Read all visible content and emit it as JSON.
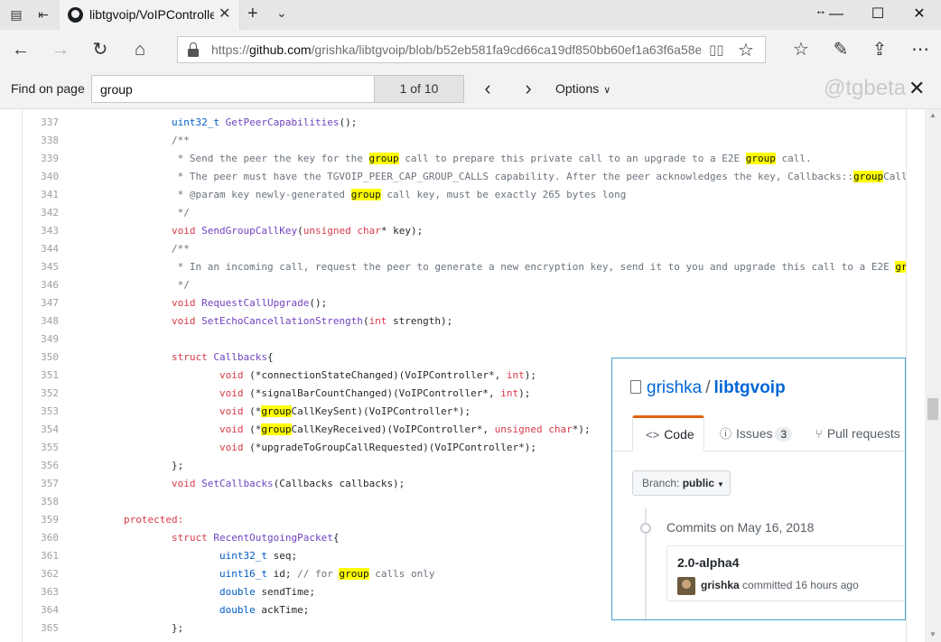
{
  "browser": {
    "tab_title": "libtgvoip/VoIPControlle",
    "url_prefix": "https://",
    "url_domain": "github.com",
    "url_path": "/grishka/libtgvoip/blob/b52eb581fa9cd66ca19df850bb60ef1a63f6a58e/VoIP"
  },
  "find_bar": {
    "label": "Find on page",
    "query": "group",
    "match_count": "1 of 10",
    "options_label": "Options",
    "watermark": "@tgbeta"
  },
  "code_lines": [
    {
      "n": "337",
      "segs": [
        [
          "t",
          "uint32_t"
        ],
        [
          "p",
          " "
        ],
        [
          "f",
          "GetPeerCapabilities"
        ],
        [
          "p",
          "();"
        ]
      ]
    },
    {
      "n": "338",
      "segs": [
        [
          "c",
          "/**"
        ]
      ]
    },
    {
      "n": "339",
      "segs": [
        [
          "c",
          " * Send the peer the key for the "
        ],
        [
          "h",
          "group"
        ],
        [
          "c",
          " call to prepare this private call to an upgrade to a E2E "
        ],
        [
          "h",
          "group"
        ],
        [
          "c",
          " call."
        ]
      ]
    },
    {
      "n": "340",
      "segs": [
        [
          "c",
          " * The peer must have the TGVOIP_PEER_CAP_GROUP_CALLS capability. After the peer acknowledges the key, Callbacks::"
        ],
        [
          "h",
          "group"
        ],
        [
          "c",
          "Call"
        ]
      ]
    },
    {
      "n": "341",
      "segs": [
        [
          "c",
          " * @param key newly-generated "
        ],
        [
          "h",
          "group"
        ],
        [
          "c",
          " call key, must be exactly 265 bytes long"
        ]
      ]
    },
    {
      "n": "342",
      "segs": [
        [
          "c",
          " */"
        ]
      ]
    },
    {
      "n": "343",
      "segs": [
        [
          "k",
          "void"
        ],
        [
          "p",
          " "
        ],
        [
          "f",
          "SendGroupCallKey"
        ],
        [
          "p",
          "("
        ],
        [
          "k",
          "unsigned"
        ],
        [
          "p",
          " "
        ],
        [
          "k",
          "char"
        ],
        [
          "p",
          "* key);"
        ]
      ]
    },
    {
      "n": "344",
      "segs": [
        [
          "c",
          "/**"
        ]
      ]
    },
    {
      "n": "345",
      "segs": [
        [
          "c",
          " * In an incoming call, request the peer to generate a new encryption key, send it to you and upgrade this call to a E2E "
        ],
        [
          "h",
          "gr"
        ]
      ]
    },
    {
      "n": "346",
      "segs": [
        [
          "c",
          " */"
        ]
      ]
    },
    {
      "n": "347",
      "segs": [
        [
          "k",
          "void"
        ],
        [
          "p",
          " "
        ],
        [
          "f",
          "RequestCallUpgrade"
        ],
        [
          "p",
          "();"
        ]
      ]
    },
    {
      "n": "348",
      "segs": [
        [
          "k",
          "void"
        ],
        [
          "p",
          " "
        ],
        [
          "f",
          "SetEchoCancellationStrength"
        ],
        [
          "p",
          "("
        ],
        [
          "k",
          "int"
        ],
        [
          "p",
          " strength);"
        ]
      ]
    },
    {
      "n": "349",
      "segs": []
    },
    {
      "n": "350",
      "segs": [
        [
          "k",
          "struct"
        ],
        [
          "p",
          " "
        ],
        [
          "f",
          "Callbacks"
        ],
        [
          "p",
          "{"
        ]
      ]
    },
    {
      "n": "351",
      "segs": [
        [
          "k",
          "void"
        ],
        [
          "p",
          " (*connectionStateChanged)(VoIPController*, "
        ],
        [
          "k",
          "int"
        ],
        [
          "p",
          ");"
        ]
      ]
    },
    {
      "n": "352",
      "segs": [
        [
          "k",
          "void"
        ],
        [
          "p",
          " (*signalBarCountChanged)(VoIPController*, "
        ],
        [
          "k",
          "int"
        ],
        [
          "p",
          ");"
        ]
      ]
    },
    {
      "n": "353",
      "segs": [
        [
          "k",
          "void"
        ],
        [
          "p",
          " (*"
        ],
        [
          "h",
          "group"
        ],
        [
          "p",
          "CallKeySent)(VoIPController*);"
        ]
      ]
    },
    {
      "n": "354",
      "segs": [
        [
          "k",
          "void"
        ],
        [
          "p",
          " (*"
        ],
        [
          "h",
          "group"
        ],
        [
          "p",
          "CallKeyReceived)(VoIPController*, "
        ],
        [
          "k",
          "unsigned"
        ],
        [
          "p",
          " "
        ],
        [
          "k",
          "char"
        ],
        [
          "p",
          "*);"
        ]
      ]
    },
    {
      "n": "355",
      "segs": [
        [
          "k",
          "void"
        ],
        [
          "p",
          " (*upgradeToGroupCallRequested)(VoIPController*);"
        ]
      ]
    },
    {
      "n": "356",
      "segs": [
        [
          "p",
          "};"
        ]
      ]
    },
    {
      "n": "357",
      "segs": [
        [
          "k",
          "void"
        ],
        [
          "p",
          " "
        ],
        [
          "f",
          "SetCallbacks"
        ],
        [
          "p",
          "(Callbacks callbacks);"
        ]
      ]
    },
    {
      "n": "358",
      "segs": []
    },
    {
      "n": "359",
      "segs": [
        [
          "k",
          "protected:"
        ]
      ]
    },
    {
      "n": "360",
      "segs": [
        [
          "k",
          "struct"
        ],
        [
          "p",
          " "
        ],
        [
          "f",
          "RecentOutgoingPacket"
        ],
        [
          "p",
          "{"
        ]
      ]
    },
    {
      "n": "361",
      "segs": [
        [
          "t",
          "uint32_t"
        ],
        [
          "p",
          " seq;"
        ]
      ]
    },
    {
      "n": "362",
      "segs": [
        [
          "t",
          "uint16_t"
        ],
        [
          "p",
          " id; "
        ],
        [
          "c",
          "// for "
        ],
        [
          "h",
          "group"
        ],
        [
          "c",
          " calls only"
        ]
      ]
    },
    {
      "n": "363",
      "segs": [
        [
          "t",
          "double"
        ],
        [
          "p",
          " sendTime;"
        ]
      ]
    },
    {
      "n": "364",
      "segs": [
        [
          "t",
          "double"
        ],
        [
          "p",
          " ackTime;"
        ]
      ]
    },
    {
      "n": "365",
      "segs": [
        [
          "p",
          "};"
        ]
      ]
    }
  ],
  "repo_panel": {
    "owner": "grishka",
    "separator": "/",
    "repo": "libtgvoip",
    "tabs": {
      "code": "Code",
      "issues": "Issues",
      "issues_count": "3",
      "pull_requests": "Pull requests"
    },
    "branch_label": "Branch:",
    "branch_name": "public",
    "commits_heading": "Commits on May 16, 2018",
    "commit_message": "2.0-alpha4",
    "commit_author": "grishka",
    "commit_meta": "committed 16 hours ago"
  }
}
